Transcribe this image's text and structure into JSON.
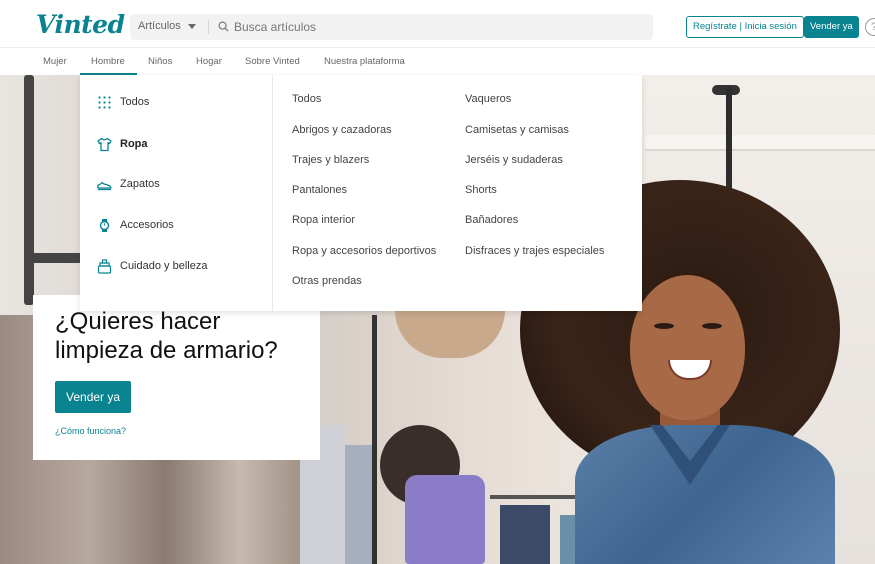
{
  "header": {
    "logo": "Vinted",
    "category_select": "Artículos",
    "search_placeholder": "Busca artículos",
    "register_label": "Regístrate | Inicia sesión",
    "sell_label": "Vender ya",
    "help_label": "?"
  },
  "nav": {
    "items": [
      "Mujer",
      "Hombre",
      "Niños",
      "Hogar",
      "Sobre Vinted",
      "Nuestra plataforma"
    ],
    "active": "Hombre"
  },
  "mega_menu": {
    "categories": [
      {
        "label": "Todos",
        "icon": "grid-icon"
      },
      {
        "label": "Ropa",
        "icon": "shirt-icon",
        "active": true
      },
      {
        "label": "Zapatos",
        "icon": "shoe-icon"
      },
      {
        "label": "Accesorios",
        "icon": "watch-icon"
      },
      {
        "label": "Cuidado y belleza",
        "icon": "beauty-icon"
      }
    ],
    "col1": [
      "Todos",
      "Abrigos y cazadoras",
      "Trajes y blazers",
      "Pantalones",
      "Ropa interior",
      "Ropa y accesorios deportivos",
      "Otras prendas"
    ],
    "col2": [
      "Vaqueros",
      "Camisetas y camisas",
      "Jerséis y sudaderas",
      "Shorts",
      "Bañadores",
      "Disfraces y trajes especiales"
    ]
  },
  "hero": {
    "title_line1": "¿Quieres hacer",
    "title_line2": "limpieza de armario?",
    "sell_label": "Vender ya",
    "how_label": "¿Cómo funciona?"
  },
  "colors": {
    "accent": "#09838f"
  }
}
